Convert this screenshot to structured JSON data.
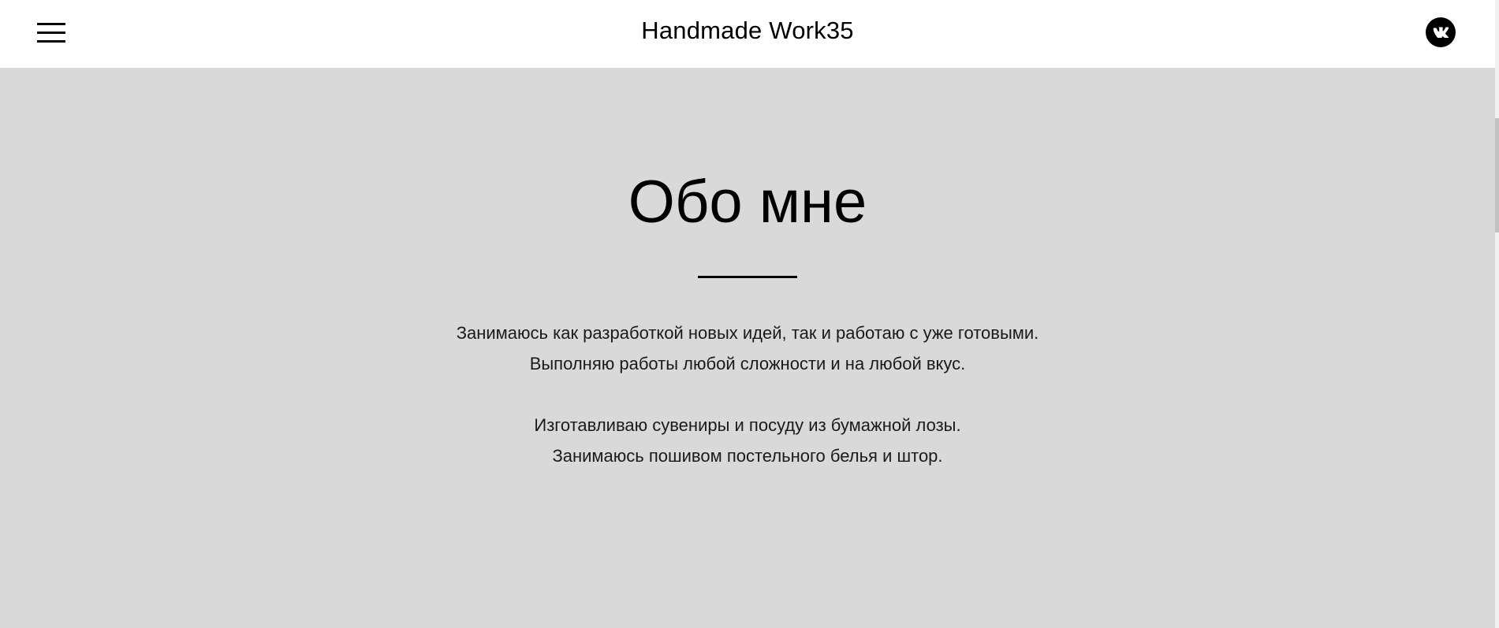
{
  "header": {
    "title": "Handmade Work35",
    "menu_icon": "hamburger-menu-icon",
    "social_icon": "vk-icon"
  },
  "about": {
    "title": "Обо мне",
    "paragraph1": {
      "line1": "Занимаюсь как разработкой новых идей, так и работаю с уже готовыми.",
      "line2": "Выполняю работы любой сложности и на любой вкус."
    },
    "paragraph2": {
      "line1": "Изготавливаю сувениры и посуду из бумажной лозы.",
      "line2": "Занимаюсь пошивом постельного белья и штор."
    }
  },
  "colors": {
    "background": "#d9d9d9",
    "header_background": "#ffffff",
    "text": "#000000",
    "accent": "#000000"
  }
}
